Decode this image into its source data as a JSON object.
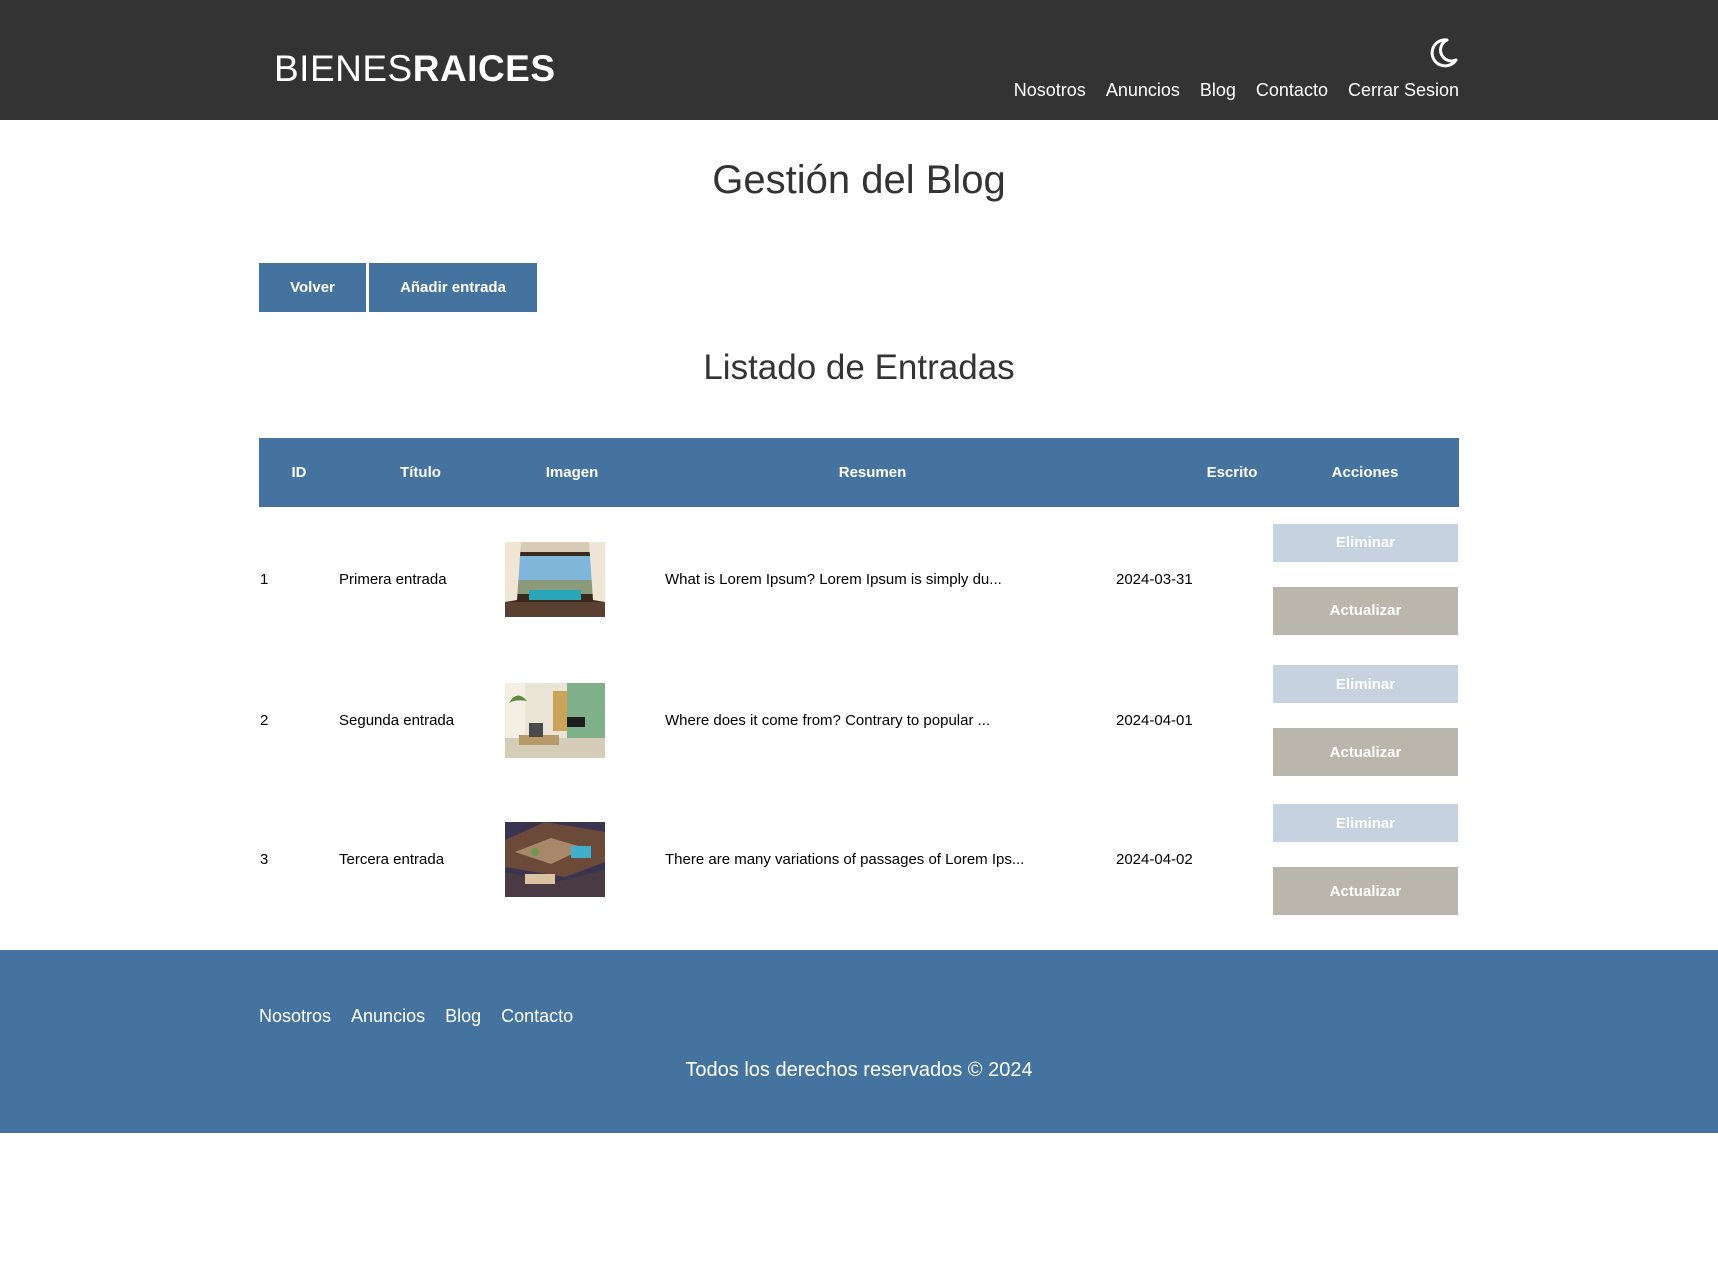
{
  "header": {
    "logo_light": "BIENES",
    "logo_bold": "RAICES",
    "dark_mode_icon": "moon-icon",
    "nav": [
      "Nosotros",
      "Anuncios",
      "Blog",
      "Contacto",
      "Cerrar Sesion"
    ]
  },
  "page": {
    "title": "Gestión del Blog",
    "back_button": "Volver",
    "add_button": "Añadir entrada",
    "list_title": "Listado de Entradas"
  },
  "table": {
    "headers": [
      "ID",
      "Título",
      "Imagen",
      "Resumen",
      "Escrito",
      "Acciones"
    ],
    "delete_label": "Eliminar",
    "update_label": "Actualizar",
    "rows": [
      {
        "id": "1",
        "title": "Primera entrada",
        "summary": "What is Lorem Ipsum? Lorem Ipsum is simply du...",
        "date": "2024-03-31"
      },
      {
        "id": "2",
        "title": "Segunda entrada",
        "summary": "Where does it come from? Contrary to popular ...",
        "date": "2024-04-01"
      },
      {
        "id": "3",
        "title": "Tercera entrada",
        "summary": "There are many variations of passages of Lorem Ips...",
        "date": "2024-04-02"
      }
    ]
  },
  "footer": {
    "nav": [
      "Nosotros",
      "Anuncios",
      "Blog",
      "Contacto"
    ],
    "copyright": "Todos los derechos reservados © 2024"
  },
  "colors": {
    "header_bg": "#333333",
    "primary_blue": "#4573a0",
    "delete_button": "#c6d2df",
    "update_button": "#bbb6ab"
  }
}
